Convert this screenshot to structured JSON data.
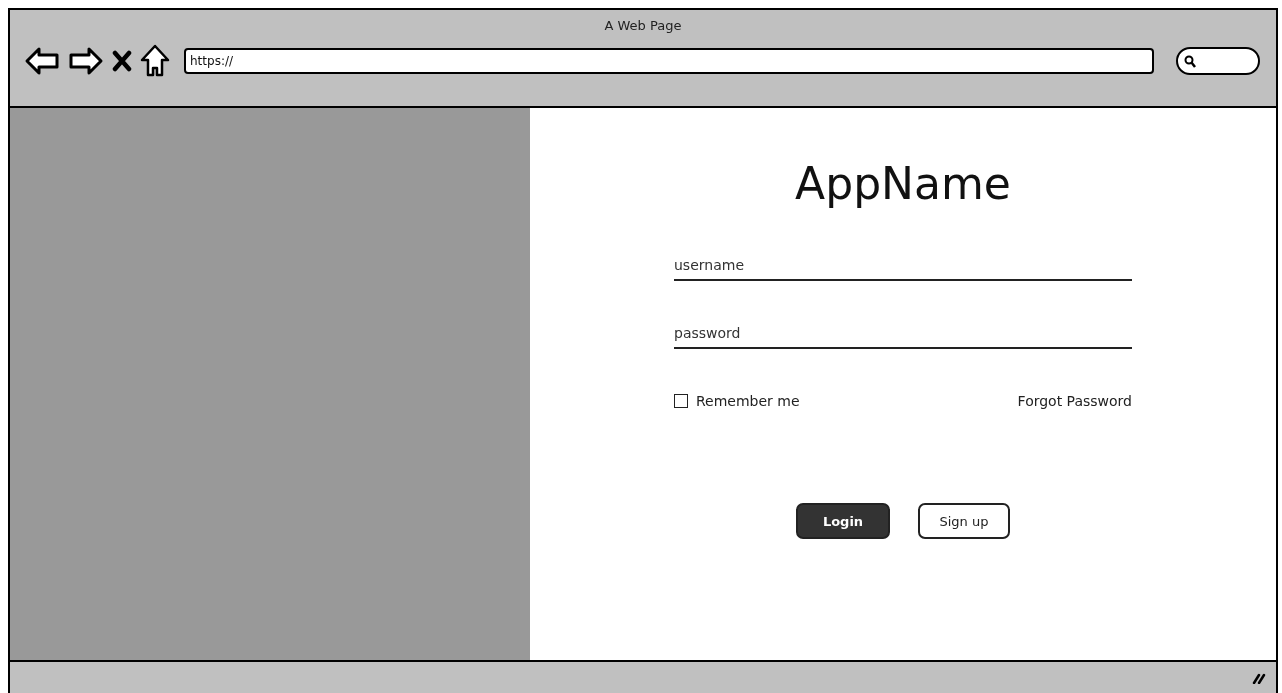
{
  "window": {
    "title": "A Web Page"
  },
  "address_bar": {
    "value": "https://"
  },
  "login": {
    "app_name": "AppName",
    "fields": [
      {
        "placeholder": "username"
      },
      {
        "placeholder": "password"
      }
    ],
    "remember": {
      "label": "Remember me",
      "checked": false
    },
    "forgot_link": "Forgot Password",
    "buttons": [
      {
        "label": "Login",
        "kind": "primary"
      },
      {
        "label": "Sign up",
        "kind": "secondary"
      }
    ]
  }
}
